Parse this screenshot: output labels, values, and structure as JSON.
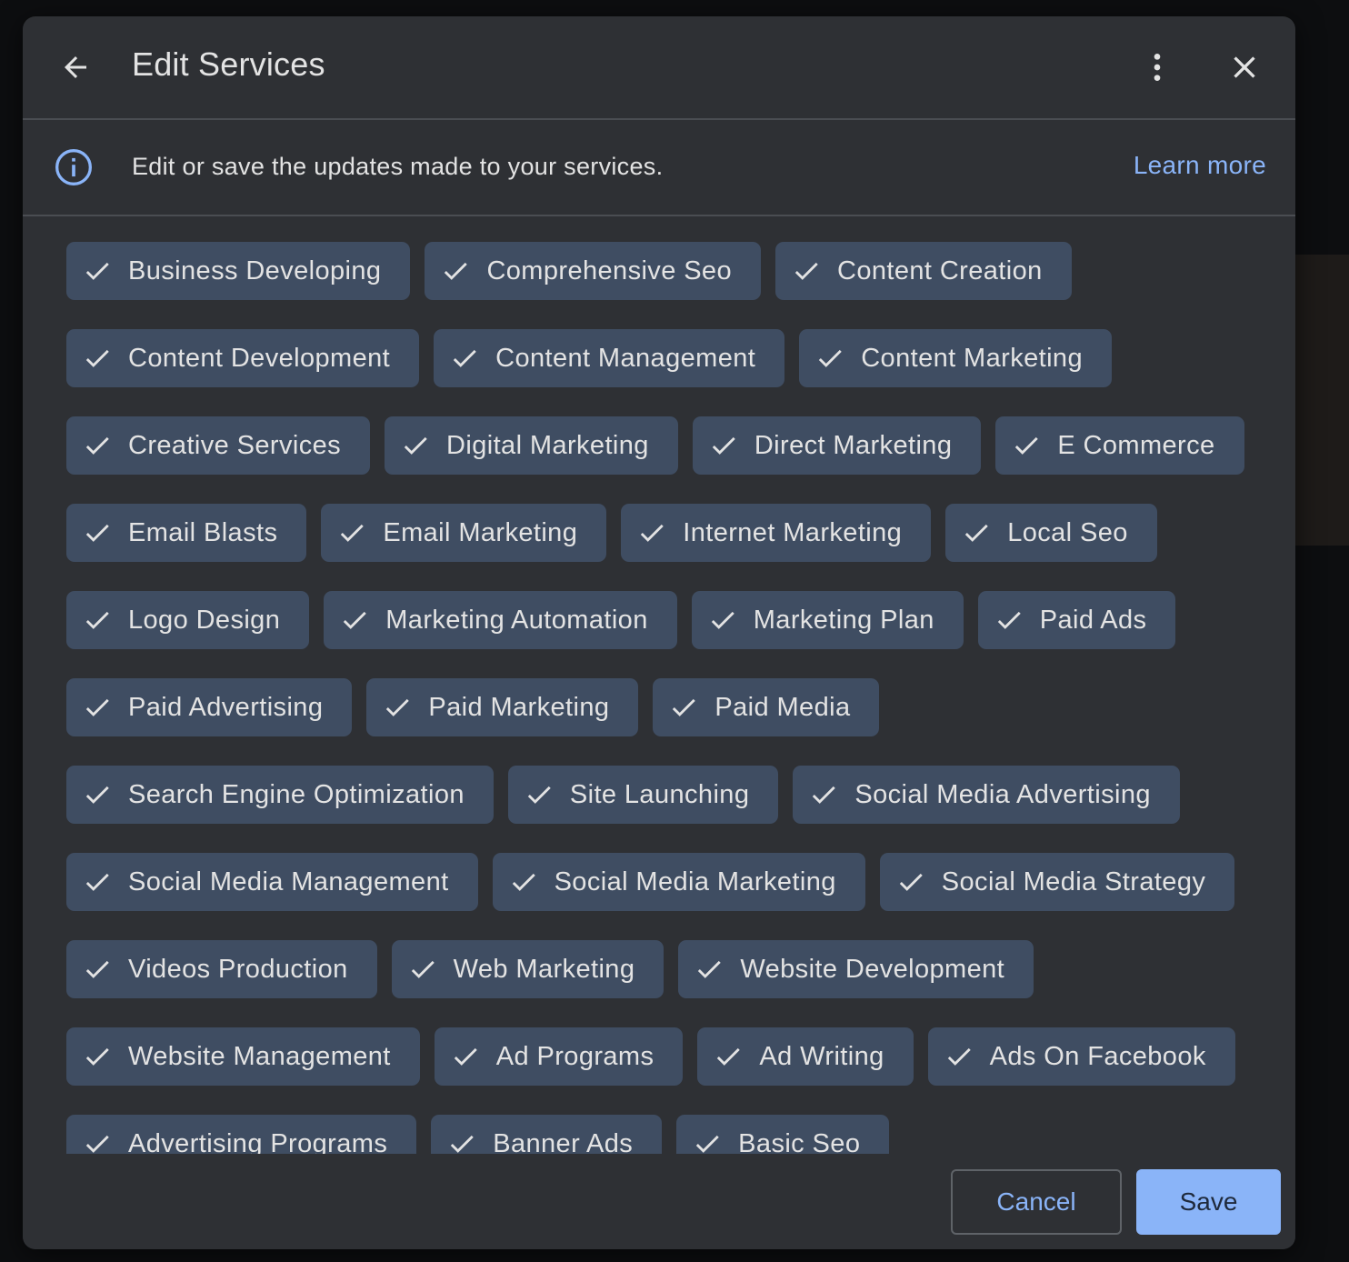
{
  "dialog": {
    "title": "Edit Services",
    "info_text": "Edit or save the updates made to your services.",
    "learn_more": "Learn more",
    "cancel_label": "Cancel",
    "save_label": "Save"
  },
  "icons": {
    "back": "arrow-back-icon",
    "more": "more-vert-icon",
    "close": "close-icon",
    "info": "info-icon",
    "check": "check-icon"
  },
  "colors": {
    "accent": "#8ab4f8",
    "chip_bg": "#3f4d62",
    "dialog_bg": "#2e3034",
    "text": "#e3e3e3"
  },
  "services": [
    "Business Developing",
    "Comprehensive Seo",
    "Content Creation",
    "Content Development",
    "Content Management",
    "Content Marketing",
    "Creative Services",
    "Digital Marketing",
    "Direct Marketing",
    "E Commerce",
    "Email Blasts",
    "Email Marketing",
    "Internet Marketing",
    "Local Seo",
    "Logo Design",
    "Marketing Automation",
    "Marketing Plan",
    "Paid Ads",
    "Paid Advertising",
    "Paid Marketing",
    "Paid Media",
    "Search Engine Optimization",
    "Site Launching",
    "Social Media Advertising",
    "Social Media Management",
    "Social Media Marketing",
    "Social Media Strategy",
    "Videos Production",
    "Web Marketing",
    "Website Development",
    "Website Management",
    "Ad Programs",
    "Ad Writing",
    "Ads On Facebook",
    "Advertising Programs",
    "Banner Ads",
    "Basic Seo"
  ]
}
